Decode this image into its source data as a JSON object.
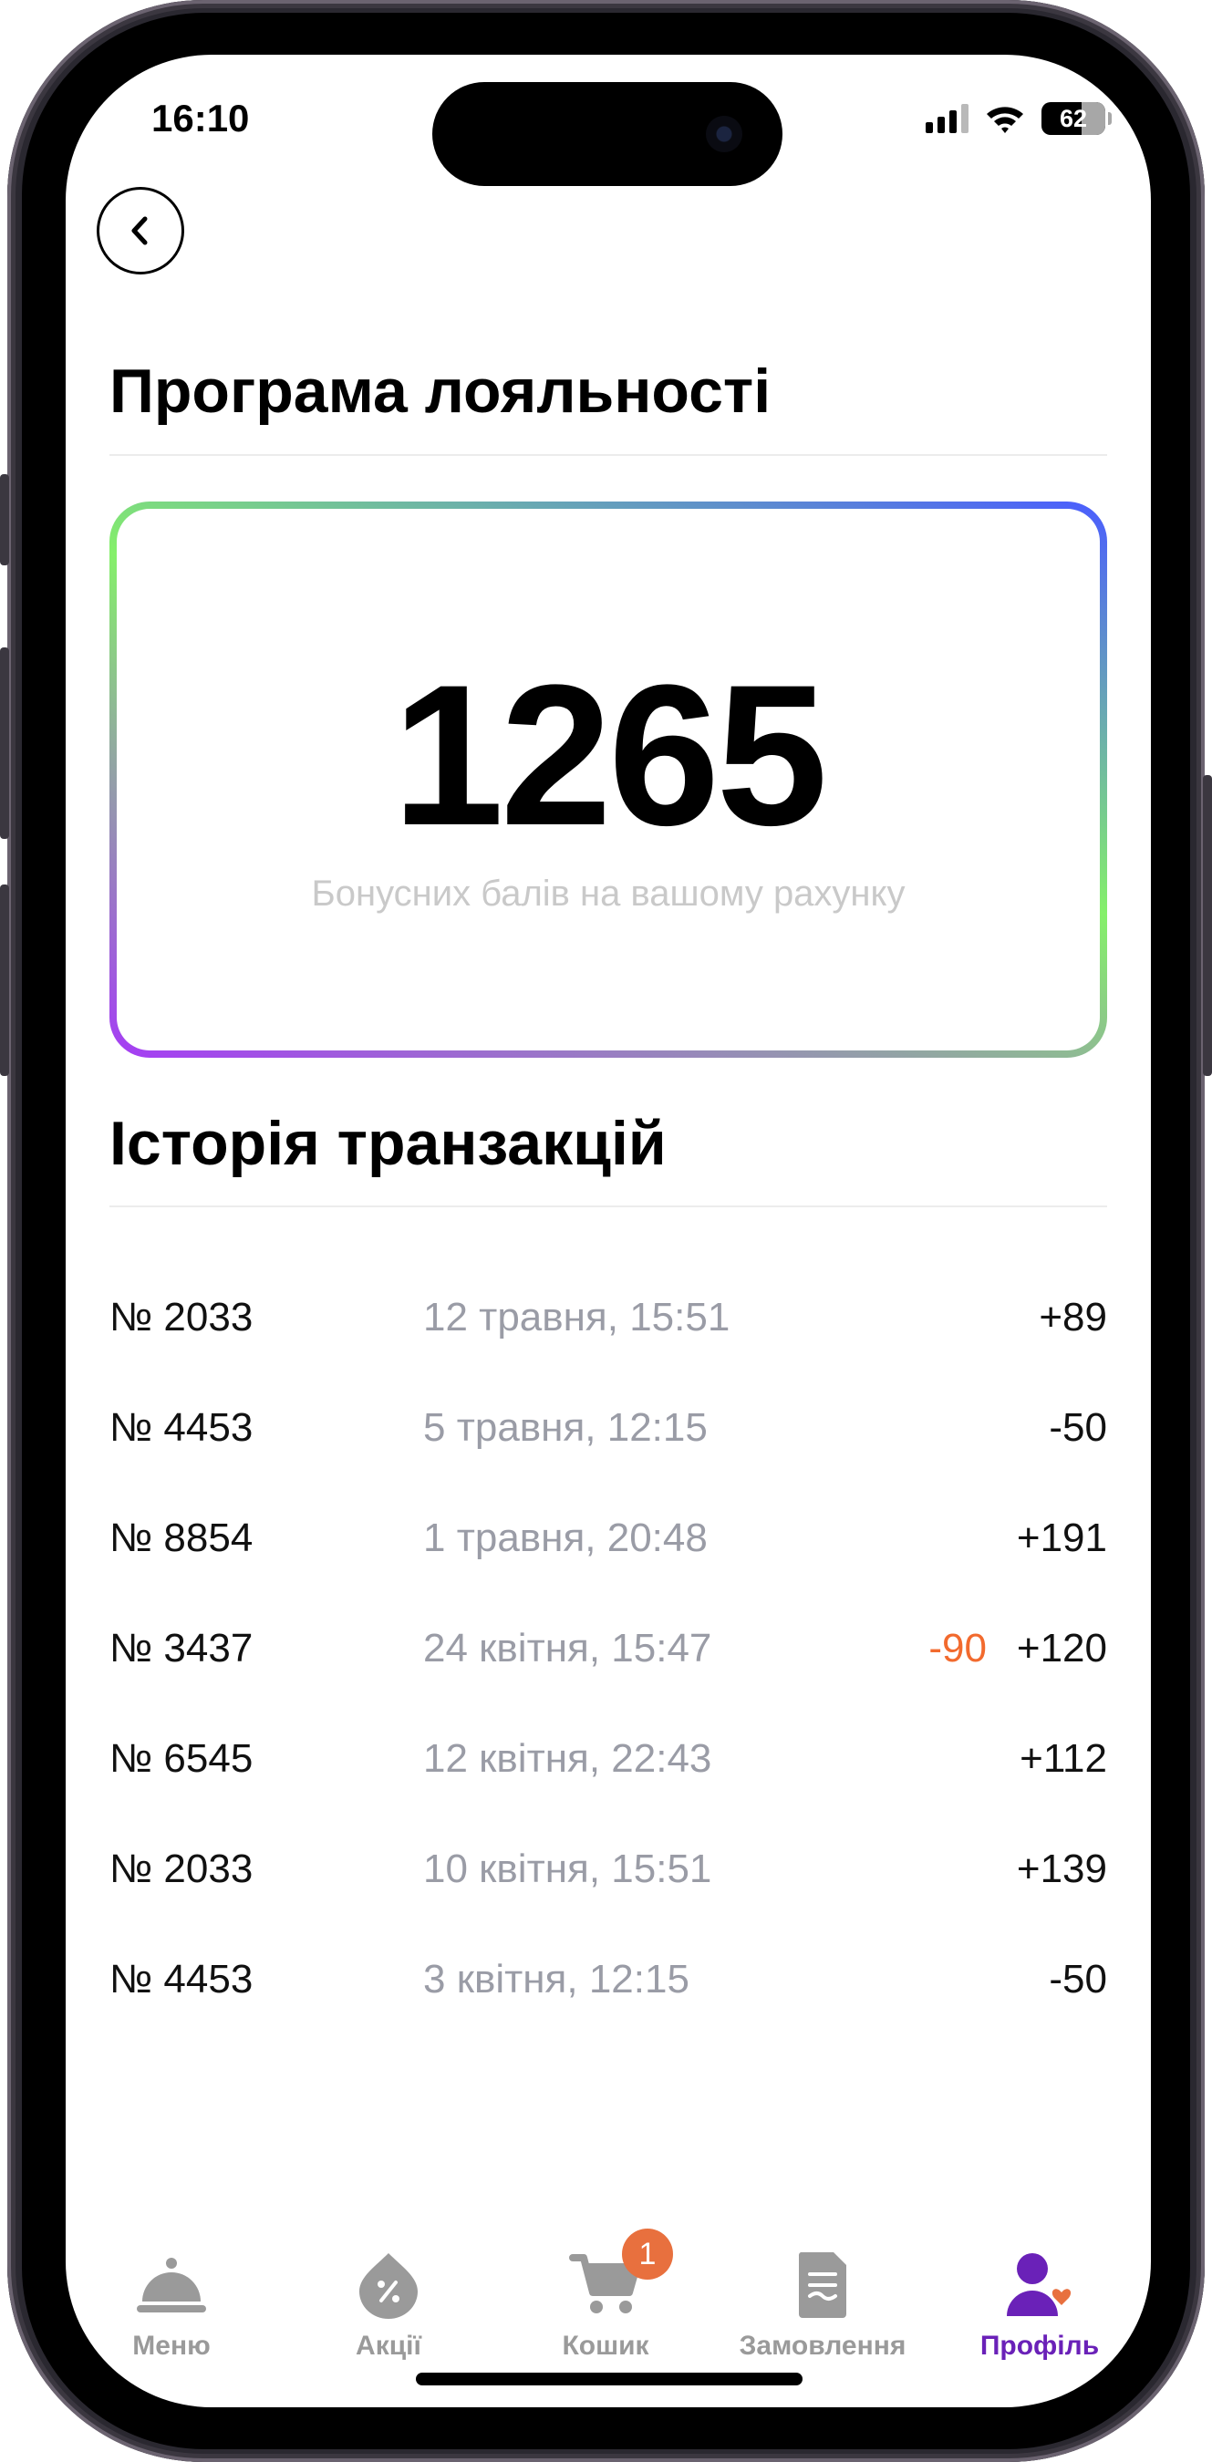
{
  "status_bar": {
    "time": "16:10",
    "battery": "62",
    "icons": [
      "cellular-signal-icon",
      "wifi-icon",
      "battery-icon"
    ]
  },
  "header": {
    "back_icon": "chevron-left-icon",
    "title": "Програма лояльності"
  },
  "loyalty_card": {
    "points": "1265",
    "caption": "Бонусних балів на вашому рахунку",
    "gradient_colors": [
      "#4a5cff",
      "#85f06a",
      "#a53cf5"
    ]
  },
  "history": {
    "title": "Історія транзакцій",
    "transactions": [
      {
        "number": "№ 2033",
        "date": "12 травня, 15:51",
        "spent": "",
        "amount": "+89"
      },
      {
        "number": "№ 4453",
        "date": "5 травня, 12:15",
        "spent": "",
        "amount": "-50"
      },
      {
        "number": "№ 8854",
        "date": "1 травня, 20:48",
        "spent": "",
        "amount": "+191"
      },
      {
        "number": "№ 3437",
        "date": "24 квітня, 15:47",
        "spent": "-90",
        "amount": "+120"
      },
      {
        "number": "№ 6545",
        "date": "12 квітня, 22:43",
        "spent": "",
        "amount": "+112"
      },
      {
        "number": "№ 2033",
        "date": "10 квітня, 15:51",
        "spent": "",
        "amount": "+139"
      },
      {
        "number": "№ 4453",
        "date": "3 квітня, 12:15",
        "spent": "",
        "amount": "-50"
      }
    ]
  },
  "tab_bar": {
    "items": [
      {
        "label": "Меню",
        "icon": "cloche-icon",
        "active": false
      },
      {
        "label": "Акції",
        "icon": "discount-tag-icon",
        "active": false
      },
      {
        "label": "Кошик",
        "icon": "cart-icon",
        "active": false,
        "badge": "1"
      },
      {
        "label": "Замовлення",
        "icon": "receipt-icon",
        "active": false
      },
      {
        "label": "Профіль",
        "icon": "profile-heart-icon",
        "active": true
      }
    ]
  },
  "colors": {
    "accent": "#6a21b8",
    "negative": "#f26a2e",
    "badge": "#e8703e",
    "muted": "#9a9ca6"
  }
}
